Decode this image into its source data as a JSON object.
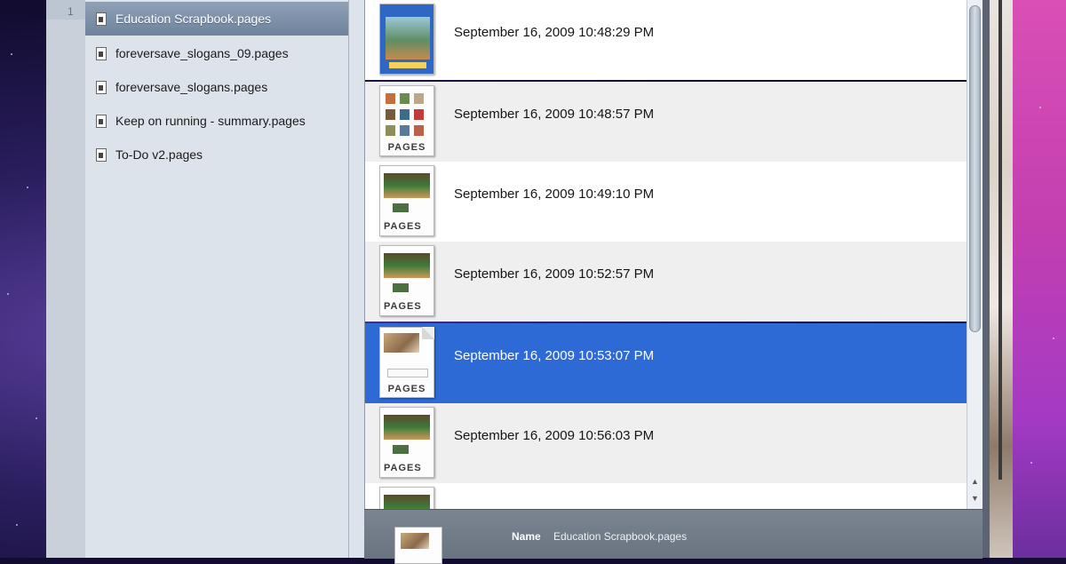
{
  "outer_list": {
    "row_number": "1"
  },
  "sidebar": {
    "items": [
      {
        "label": "Education Scrapbook.pages",
        "selected": true
      },
      {
        "label": "foreversave_slogans_09.pages",
        "selected": false
      },
      {
        "label": "foreversave_slogans.pages",
        "selected": false
      },
      {
        "label": "Keep on running - summary.pages",
        "selected": false
      },
      {
        "label": "To-Do v2.pages",
        "selected": false
      }
    ]
  },
  "versions": {
    "rows": [
      {
        "date": "September 16, 2009 10:48:29 PM",
        "thumbnail": "scrapbook-cover-thumbnail"
      },
      {
        "date": "September 16, 2009 10:48:57 PM",
        "thumbnail": "photo-grid-thumbnail",
        "thumb_label": "PAGES"
      },
      {
        "date": "September 16, 2009 10:49:10 PM",
        "thumbnail": "banner-thumbnail",
        "thumb_label": "PAGES"
      },
      {
        "date": "September 16, 2009 10:52:57 PM",
        "thumbnail": "banner-thumbnail",
        "thumb_label": "PAGES"
      },
      {
        "date": "September 16, 2009 10:53:07 PM",
        "thumbnail": "sketch-thumbnail",
        "thumb_label": "PAGES",
        "selected": true
      },
      {
        "date": "September 16, 2009 10:56:03 PM",
        "thumbnail": "banner-thumbnail",
        "thumb_label": "PAGES"
      }
    ]
  },
  "info_bar": {
    "name_label": "Name",
    "name_value": "Education Scrapbook.pages"
  },
  "colors": {
    "selection_blue": "#2d6ad6",
    "sidebar_bg": "#dde3ea",
    "info_bar_bg": "#6f7986"
  }
}
